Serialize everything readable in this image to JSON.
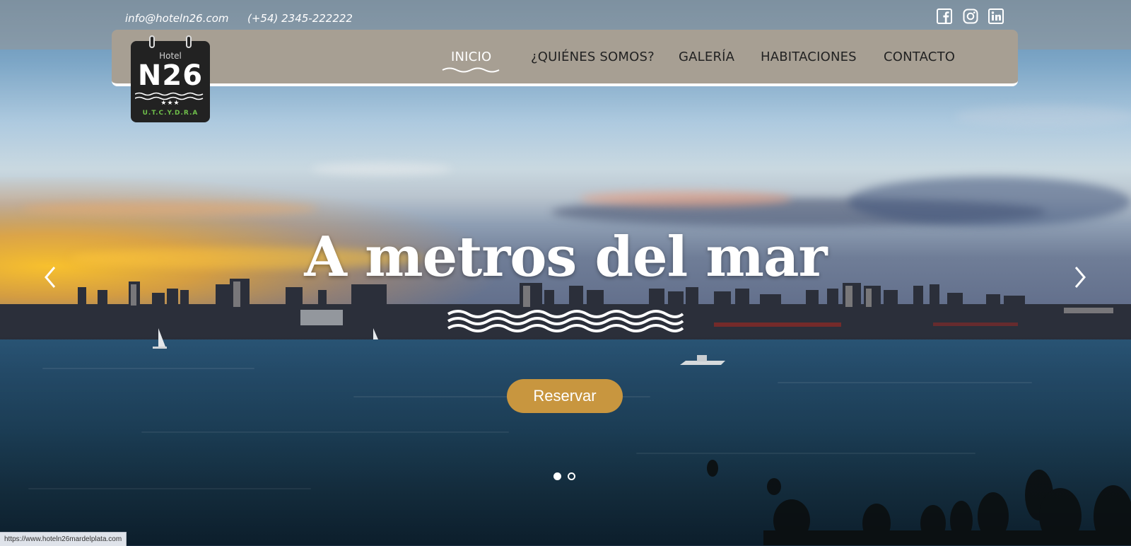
{
  "topbar": {
    "email": "info@hoteln26.com",
    "phone": "(+54) 2345-222222",
    "social": [
      {
        "icon": "facebook-icon"
      },
      {
        "icon": "instagram-icon"
      },
      {
        "icon": "linkedin-icon"
      }
    ]
  },
  "logo": {
    "hotel": "Hotel",
    "name": "N26",
    "stars": "★★★",
    "subtitle": "U.T.C.Y.D.R.A"
  },
  "nav": {
    "items": [
      {
        "label": "INICIO",
        "active": true
      },
      {
        "label": "¿QUIÉNES SOMOS?"
      },
      {
        "label": "GALERÍA"
      },
      {
        "label": "HABITACIONES"
      },
      {
        "label": "CONTACTO"
      }
    ]
  },
  "hero": {
    "title": "A metros del mar",
    "button_label": "Reservar",
    "slides_total": 2,
    "active_slide": 1
  },
  "status_url": "https://www.hoteln26mardelplata.com",
  "colors": {
    "nav_bg": "#a79f93",
    "button": "#c8963f",
    "logo_bg": "#222222",
    "logo_accent": "#6fbf4a"
  }
}
